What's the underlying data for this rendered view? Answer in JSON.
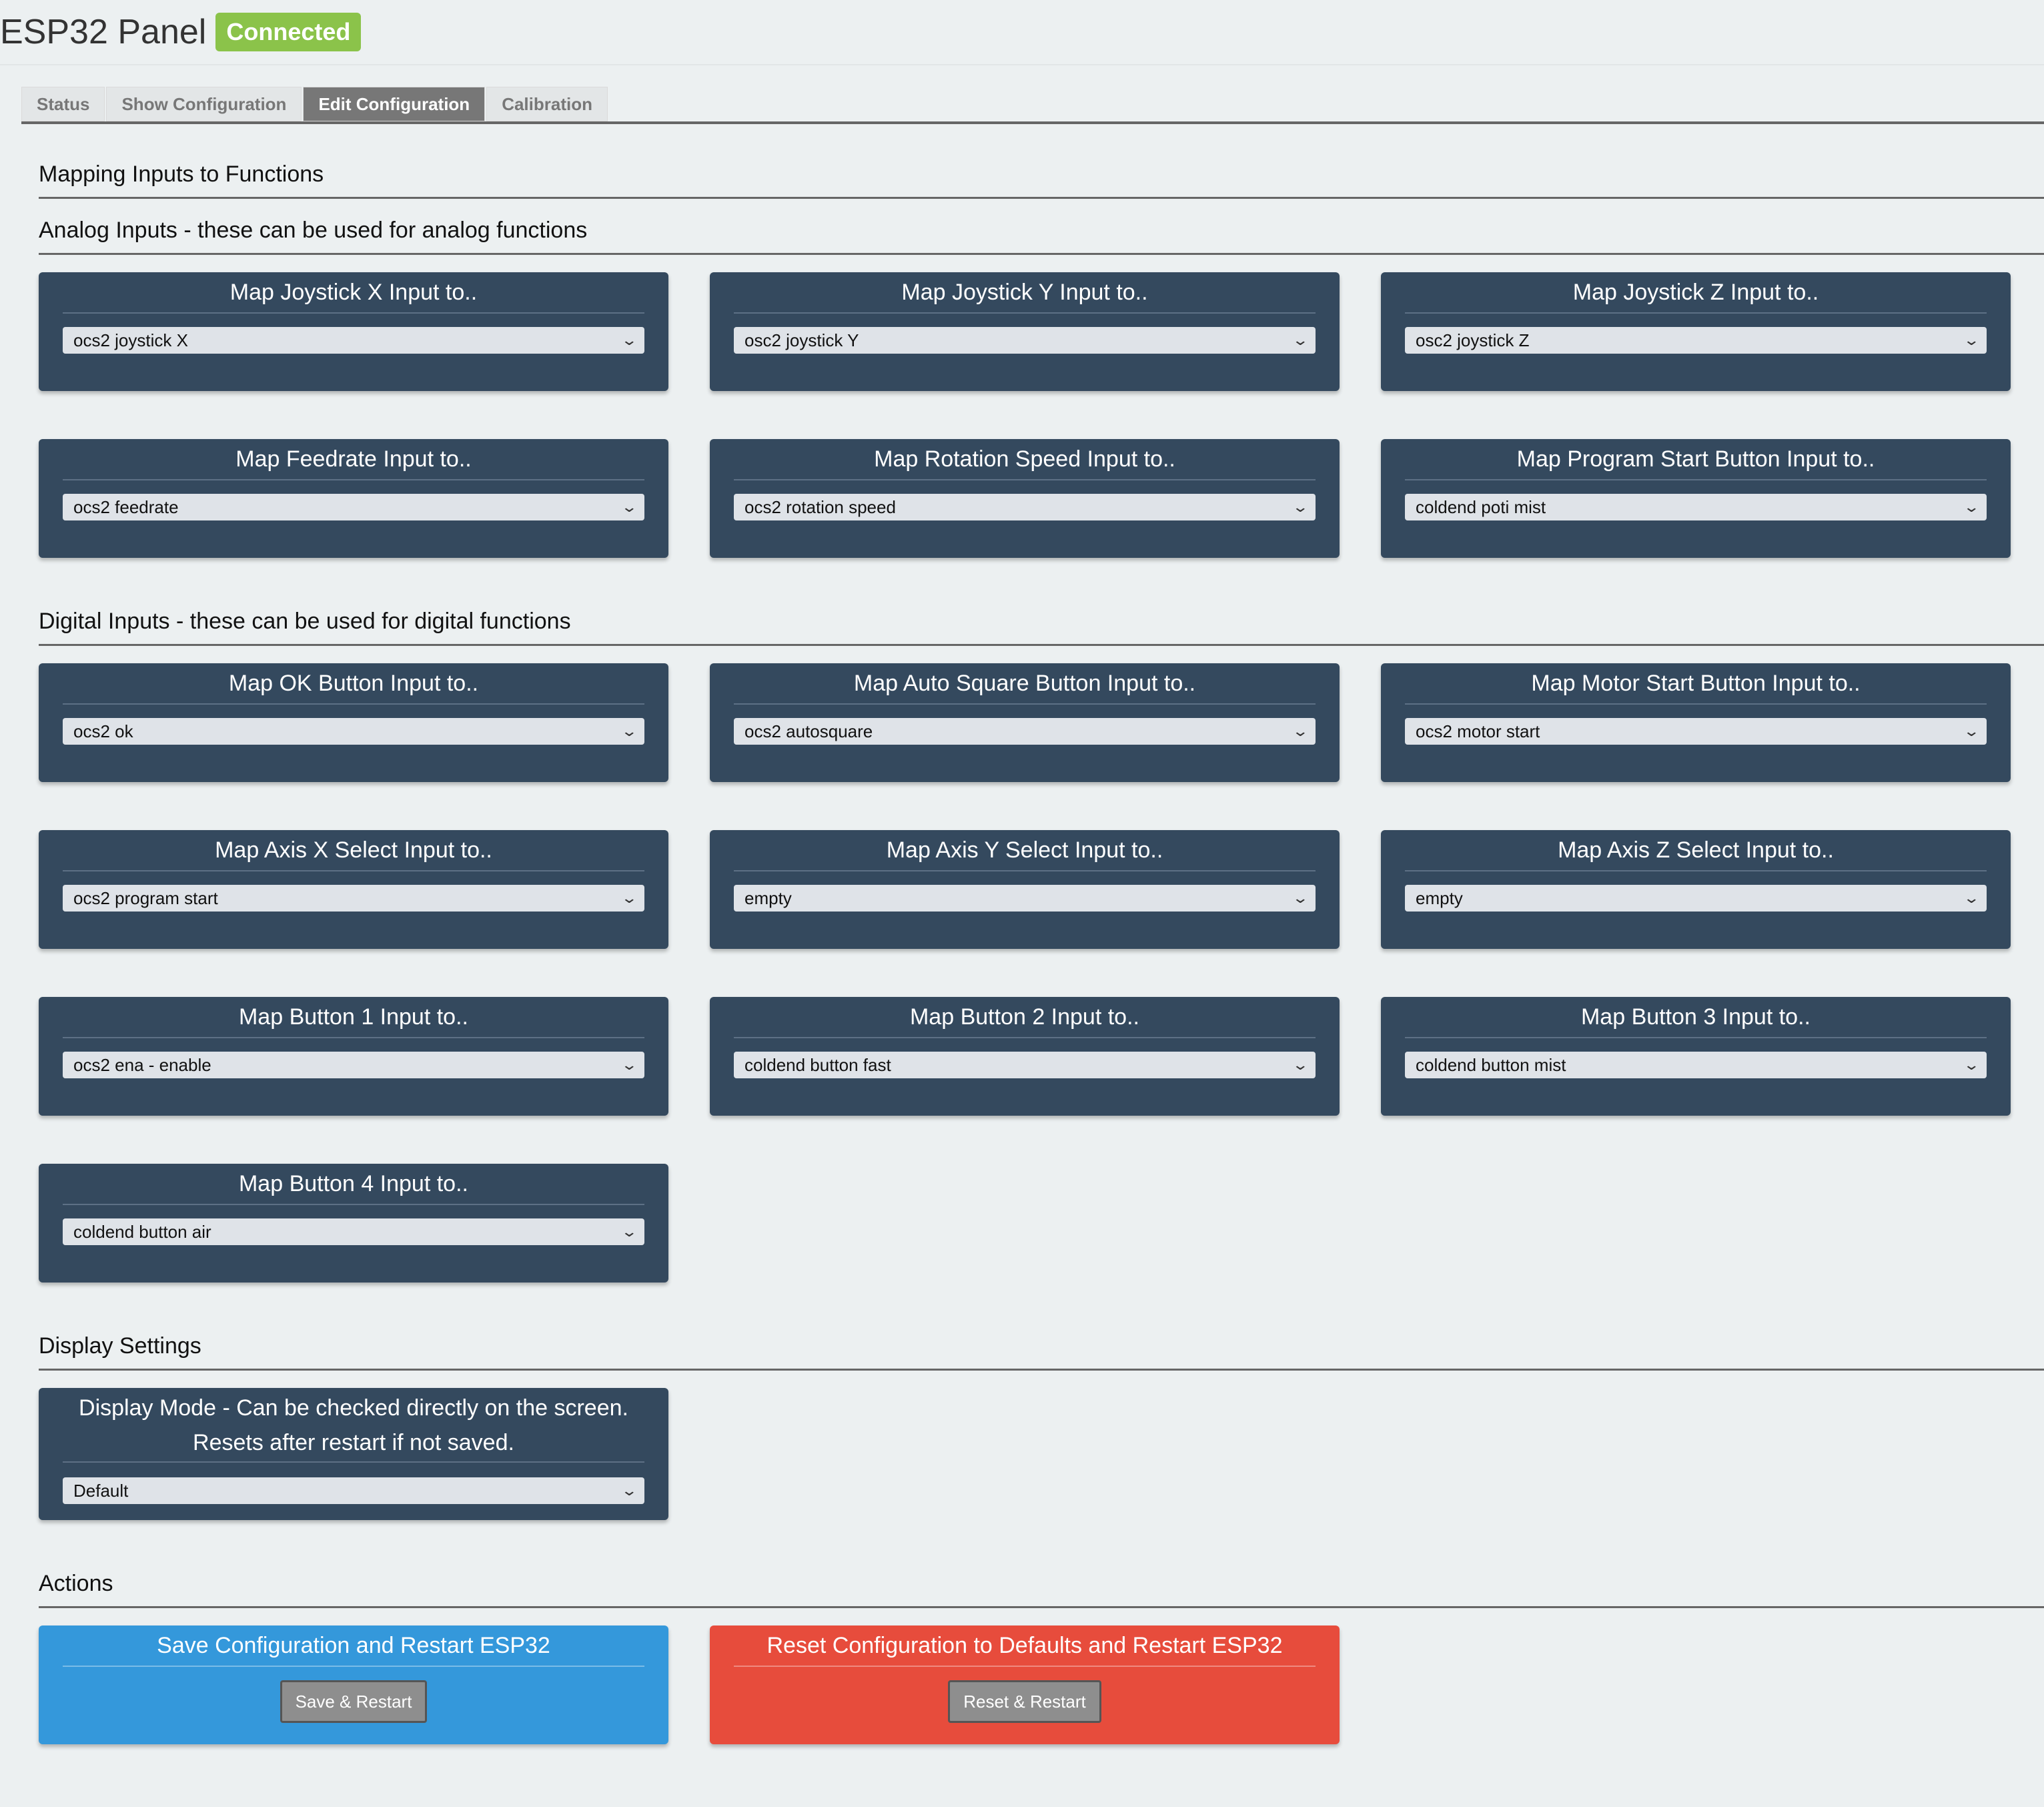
{
  "header": {
    "title": "ESP32 Panel",
    "status": "Connected"
  },
  "tabs": [
    "Status",
    "Show Configuration",
    "Edit Configuration",
    "Calibration"
  ],
  "sections": {
    "mapping": "Mapping Inputs to Functions",
    "analog": "Analog Inputs - these can be used for analog functions",
    "digital": "Digital Inputs - these can be used for digital functions",
    "display": "Display Settings",
    "actions": "Actions"
  },
  "analog": [
    {
      "label": "Map Joystick X Input to..",
      "value": "ocs2 joystick X"
    },
    {
      "label": "Map Joystick Y Input to..",
      "value": "osc2 joystick Y"
    },
    {
      "label": "Map Joystick Z Input to..",
      "value": "osc2 joystick Z"
    },
    {
      "label": "Map Feedrate Input to..",
      "value": "ocs2 feedrate"
    },
    {
      "label": "Map Rotation Speed Input to..",
      "value": "ocs2 rotation speed"
    },
    {
      "label": "Map Program Start Button Input to..",
      "value": "coldend poti mist"
    }
  ],
  "digital": [
    {
      "label": "Map OK Button Input to..",
      "value": "ocs2 ok"
    },
    {
      "label": "Map Auto Square Button Input to..",
      "value": "ocs2 autosquare"
    },
    {
      "label": "Map Motor Start Button Input to..",
      "value": "ocs2 motor start"
    },
    {
      "label": "Map Axis X Select Input to..",
      "value": "ocs2 program start"
    },
    {
      "label": "Map Axis Y Select Input to..",
      "value": "empty"
    },
    {
      "label": "Map Axis Z Select Input to..",
      "value": "empty"
    },
    {
      "label": "Map Button 1 Input to..",
      "value": "ocs2 ena - enable"
    },
    {
      "label": "Map Button 2 Input to..",
      "value": "coldend button fast"
    },
    {
      "label": "Map Button 3 Input to..",
      "value": "coldend button mist"
    },
    {
      "label": "Map Button 4 Input to..",
      "value": "coldend button air"
    }
  ],
  "display": {
    "label_line1": "Display Mode - Can be checked directly on the screen.",
    "label_line2": "Resets after restart if not saved.",
    "value": "Default"
  },
  "actions": {
    "save": {
      "label": "Save Configuration and Restart ESP32",
      "button": "Save & Restart",
      "color": "#3498db"
    },
    "reset": {
      "label": "Reset Configuration to Defaults and Restart ESP32",
      "button": "Reset & Restart",
      "color": "#e74c3c"
    }
  },
  "colors": {
    "card": "#34495e",
    "badge": "#8bc34a",
    "background": "#ecf0f1"
  }
}
